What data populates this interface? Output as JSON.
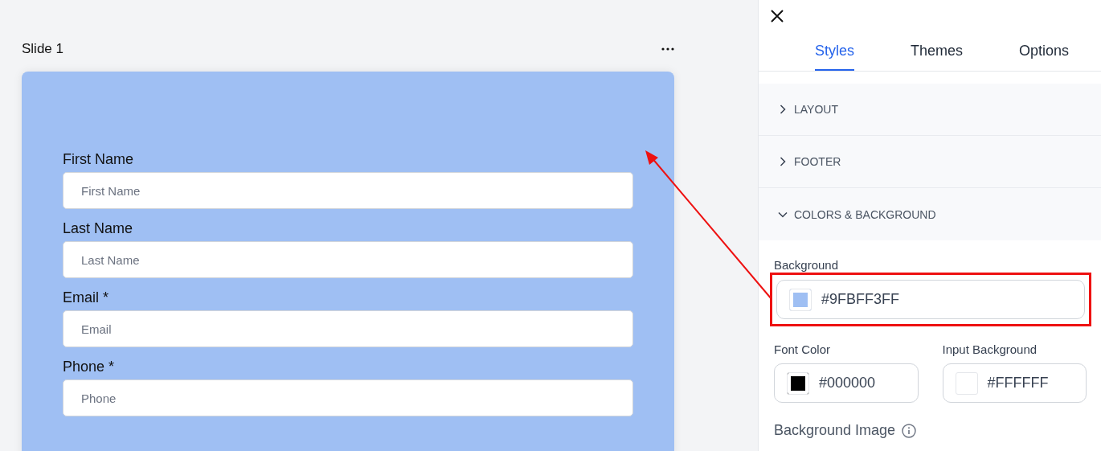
{
  "slide": {
    "title": "Slide 1",
    "fields": [
      {
        "label": "First Name",
        "placeholder": "First Name"
      },
      {
        "label": "Last Name",
        "placeholder": "Last Name"
      },
      {
        "label": "Email *",
        "placeholder": "Email"
      },
      {
        "label": "Phone *",
        "placeholder": "Phone"
      }
    ]
  },
  "panel": {
    "tabs": [
      {
        "label": "Styles",
        "selected": true
      },
      {
        "label": "Themes",
        "selected": false
      },
      {
        "label": "Options",
        "selected": false
      }
    ],
    "sections": [
      {
        "label": "LAYOUT",
        "expanded": false
      },
      {
        "label": "FOOTER",
        "expanded": false
      },
      {
        "label": "COLORS & BACKGROUND",
        "expanded": true
      }
    ],
    "background": {
      "label": "Background",
      "value": "#9FBFF3FF",
      "color": "#9fbff3",
      "highlighted": true
    },
    "color_fields": [
      {
        "label": "Font Color",
        "value": "#000000",
        "color": "#000000"
      },
      {
        "label": "Input Background",
        "value": "#FFFFFF",
        "color": "#ffffff"
      }
    ],
    "background_image": {
      "label": "Background Image"
    }
  }
}
